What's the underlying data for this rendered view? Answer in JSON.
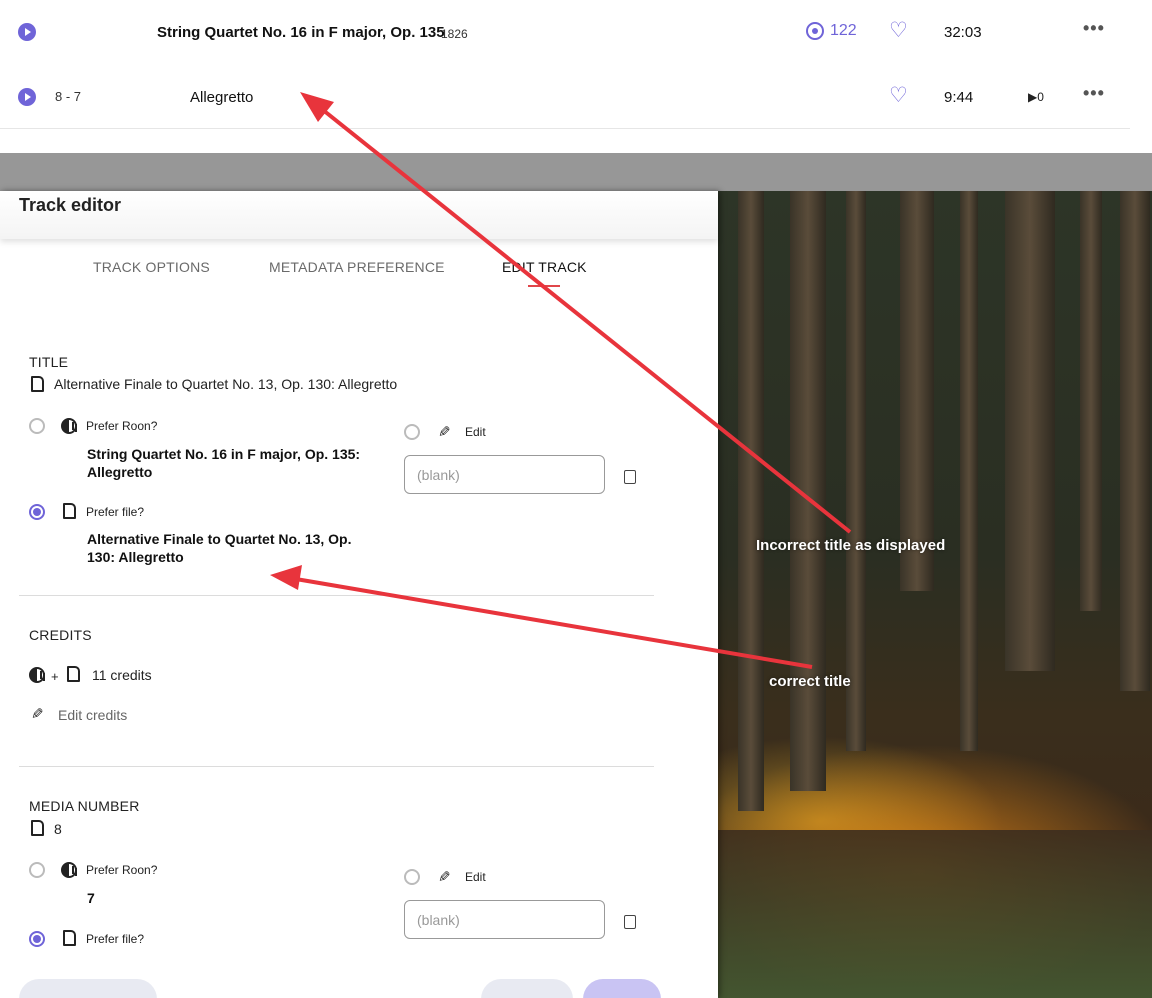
{
  "tracks": [
    {
      "title": "String Quartet No. 16 in F major, Op. 135",
      "year": "1826",
      "plays": "122",
      "duration": "32:03"
    },
    {
      "number": "8 - 7",
      "title": "Allegretto",
      "duration": "9:44",
      "playcount": "▶0"
    }
  ],
  "editor": {
    "title": "Track editor",
    "tabs": [
      "TRACK OPTIONS",
      "METADATA PREFERENCE",
      "EDIT TRACK"
    ],
    "title_section": {
      "label": "TITLE",
      "file_value": "Alternative Finale to Quartet No. 13, Op. 130: Allegretto",
      "prefer_roon_label": "Prefer Roon?",
      "roon_value_line1": "String Quartet No. 16 in F major, Op. 135:",
      "roon_value_line2": "Allegretto",
      "prefer_file_label": "Prefer file?",
      "file_option_line1": "Alternative Finale to Quartet No. 13, Op.",
      "file_option_line2": "130: Allegretto",
      "edit_label": "Edit",
      "edit_placeholder": "(blank)"
    },
    "credits_section": {
      "label": "CREDITS",
      "plus": "+",
      "count": "11 credits",
      "edit_label": "Edit credits"
    },
    "media_section": {
      "label": "MEDIA NUMBER",
      "file_value": "8",
      "prefer_roon_label": "Prefer Roon?",
      "roon_value": "7",
      "prefer_file_label": "Prefer file?",
      "edit_label": "Edit",
      "edit_placeholder": "(blank)"
    }
  },
  "annotations": {
    "incorrect": "Incorrect title as displayed",
    "correct": "correct title"
  },
  "colors": {
    "accent": "#6f64d8",
    "arrow": "#e8343c",
    "tab_underline": "#e0464a"
  }
}
